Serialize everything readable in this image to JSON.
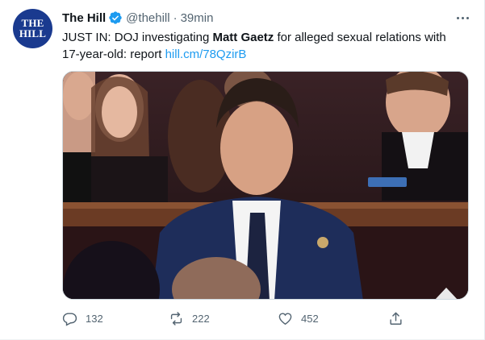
{
  "tweet": {
    "display_name": "The Hill",
    "verified": true,
    "handle": "@thehill",
    "separator": "·",
    "time": "39min",
    "avatar_text_line1": "THE",
    "avatar_text_line2": "HILL",
    "text_prefix": "JUST IN: DOJ investigating ",
    "text_bold": "Matt Gaetz",
    "text_middle": " for alleged sexual relations with 17-year-old: report ",
    "link": "hill.cm/78QzirB",
    "image_subject": "man-in-suit-seated-in-chamber-photo"
  },
  "actions": {
    "reply_count": "132",
    "retweet_count": "222",
    "like_count": "452"
  },
  "colors": {
    "accent": "#1d9bf0",
    "secondary_text": "#536471",
    "avatar_bg": "#1a3a8f"
  }
}
